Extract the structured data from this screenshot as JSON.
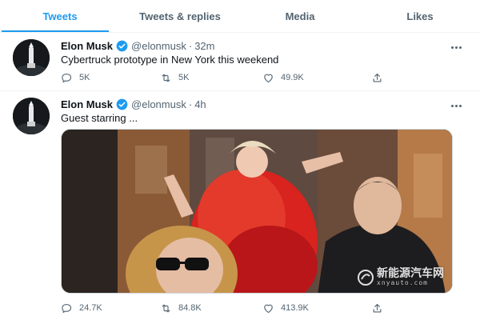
{
  "tabs": [
    {
      "label": "Tweets",
      "active": true
    },
    {
      "label": "Tweets & replies",
      "active": false
    },
    {
      "label": "Media",
      "active": false
    },
    {
      "label": "Likes",
      "active": false
    }
  ],
  "accent_color": "#1d9bf0",
  "tweets": [
    {
      "author_name": "Elon Musk",
      "handle": "@elonmusk",
      "separator": "·",
      "time": "32m",
      "text": "Cybertruck prototype in New York this weekend",
      "replies": "5K",
      "retweets": "5K",
      "likes": "49.9K",
      "icons": {
        "reply": "reply-icon",
        "retweet": "retweet-icon",
        "like": "heart-icon",
        "share": "share-icon"
      }
    },
    {
      "author_name": "Elon Musk",
      "handle": "@elonmusk",
      "separator": "·",
      "time": "4h",
      "text": "Guest starring ...",
      "replies": "24.7K",
      "retweets": "84.8K",
      "likes": "413.9K",
      "media": {
        "type": "photo",
        "watermark_text": "新能源汽车网",
        "watermark_sub": "xnyauto.com"
      },
      "icons": {
        "reply": "reply-icon",
        "retweet": "retweet-icon",
        "like": "heart-icon",
        "share": "share-icon"
      }
    }
  ]
}
